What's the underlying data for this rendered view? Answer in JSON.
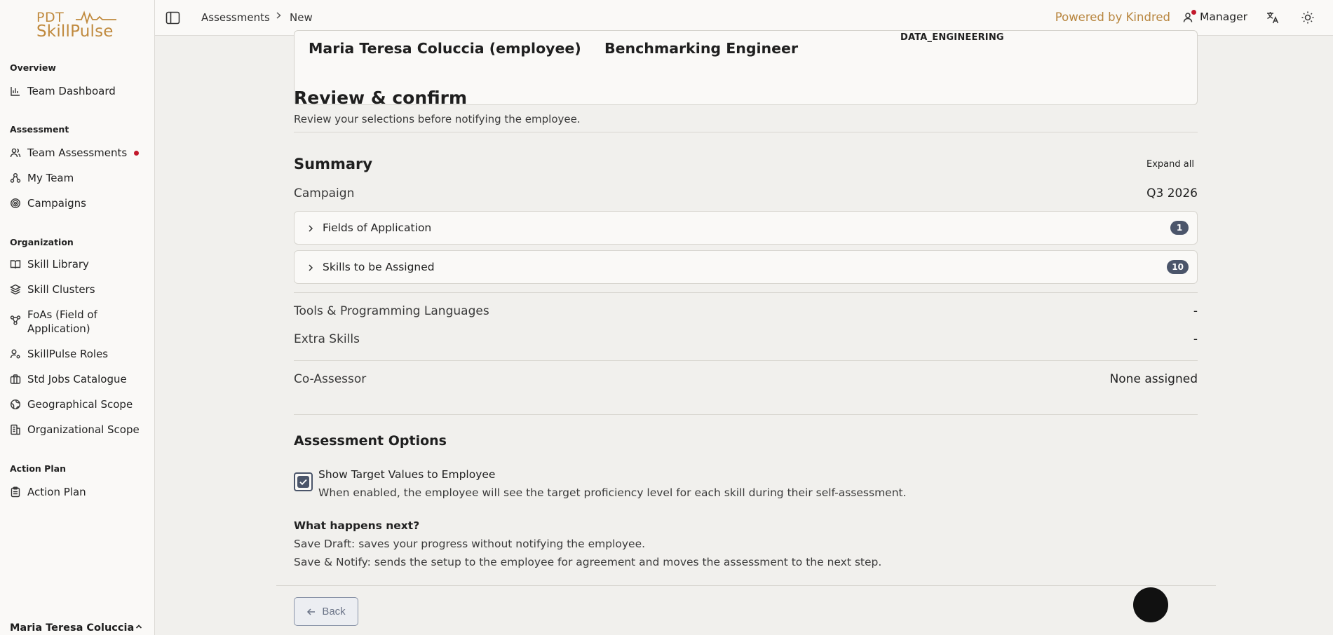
{
  "logo": {
    "line1": "PDT",
    "line2": "SkillPulse"
  },
  "sidebar": {
    "sections": {
      "overview": "Overview",
      "assessment": "Assessment",
      "organization": "Organization",
      "action_plan": "Action Plan"
    },
    "items": {
      "team_dashboard": "Team Dashboard",
      "team_assessments": "Team Assessments",
      "my_team": "My Team",
      "campaigns": "Campaigns",
      "skill_library": "Skill Library",
      "skill_clusters": "Skill Clusters",
      "foas_line1": "FoAs (Field of",
      "foas_line2": "Application)",
      "skillpulse_roles": "SkillPulse Roles",
      "std_jobs": "Std Jobs Catalogue",
      "geo_scope": "Geographical Scope",
      "org_scope": "Organizational Scope",
      "action_plan": "Action Plan"
    },
    "user_name": "Maria Teresa Coluccia"
  },
  "header": {
    "breadcrumb": [
      "Assessments",
      "New"
    ],
    "powered_by": "Powered by Kindred",
    "role": "Manager"
  },
  "employee_card": {
    "name": "Maria Teresa Coluccia (employee)",
    "job_title": "Benchmarking Engineer",
    "department": "DATA_ENGINEERING"
  },
  "review": {
    "title": "Review & confirm",
    "subtitle": "Review your selections before notifying the employee."
  },
  "summary": {
    "title": "Summary",
    "expand_all": "Expand all",
    "campaign_label": "Campaign",
    "campaign_value": "Q3 2026",
    "accordions": [
      {
        "label": "Fields of Application",
        "count": "1"
      },
      {
        "label": "Skills to be Assigned",
        "count": "10"
      }
    ],
    "tools_label": "Tools & Programming Languages",
    "tools_value": "-",
    "extra_label": "Extra Skills",
    "extra_value": "-",
    "coassessor_label": "Co-Assessor",
    "coassessor_value": "None assigned"
  },
  "options": {
    "title": "Assessment Options",
    "show_target_label": "Show Target Values to Employee",
    "show_target_desc": "When enabled, the employee will see the target proficiency level for each skill during their self-assessment.",
    "show_target_checked": true
  },
  "next": {
    "title": "What happens next?",
    "line1": "Save Draft: saves your progress without notifying the employee.",
    "line2": "Save & Notify: sends the setup to the employee for agreement and moves the assessment to the next step."
  },
  "footer": {
    "back_label": "Back"
  },
  "colors": {
    "accent": "#b8863f",
    "badge": "#4b556a",
    "alert": "#c2182b"
  }
}
